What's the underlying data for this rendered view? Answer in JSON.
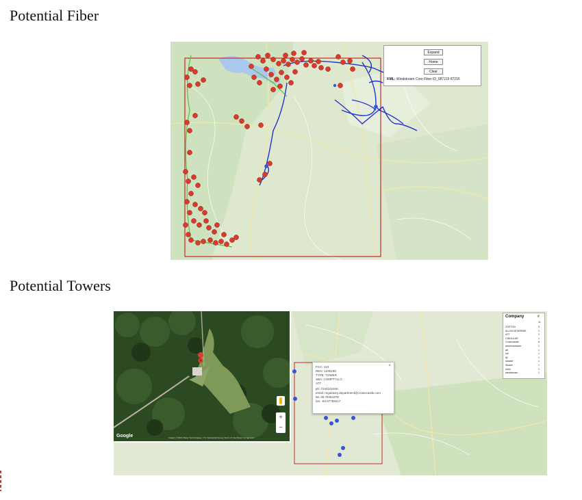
{
  "headings": {
    "fiber": "Potential Fiber",
    "towers": "Potential Towers"
  },
  "fiber_map": {
    "controls": {
      "expand": "Expand",
      "home": "Home",
      "clear": "Clear"
    },
    "kml_label": "KML:",
    "kml_value": "Windstream Core Fiber ID_087215 87216",
    "colors": {
      "fiber_route": "#2233cc",
      "marker": "#d93a2b",
      "boundary": "#c62828",
      "green_route": "#55c040"
    }
  },
  "towers_map": {
    "google_logo": "Google",
    "satellite_credit": "Imagery ©2021 Maxar Technologies, U.S. Geological Survey  Terms of Use  Report a map error",
    "zoom": {
      "in": "+",
      "out": "−"
    },
    "info_window": {
      "close": "×",
      "lines": [
        "FCC: 123",
        "REG: 1245199",
        "TYPE: TOWER",
        "SBA: COMPTYLLC",
        "ATT",
        "ph: 7244102200",
        "email: regulatory.department@crowncastle.com",
        "lat: 36.784542TE",
        "lon: -84.07799417"
      ]
    },
    "legend": {
      "header": "Company",
      "count_header": "#",
      "total": "11",
      "rows": [
        {
          "name": "2GETON",
          "count": "3"
        },
        {
          "name": "ALLINCATHERINE",
          "count": "1"
        },
        {
          "name": "ATT",
          "count": "1"
        },
        {
          "name": "CINGULAR",
          "count": "1"
        },
        {
          "name": "Crowncastle",
          "count": "8"
        },
        {
          "name": "americantower",
          "count": "1"
        },
        {
          "name": "att",
          "count": "1"
        },
        {
          "name": "lob",
          "count": "1"
        },
        {
          "name": "tiji",
          "count": "1"
        },
        {
          "name": "sbasite",
          "count": "1"
        },
        {
          "name": "Sitoble",
          "count": "1"
        },
        {
          "name": "verlo",
          "count": "1"
        },
        {
          "name": "windstream",
          "count": "1"
        }
      ]
    }
  }
}
